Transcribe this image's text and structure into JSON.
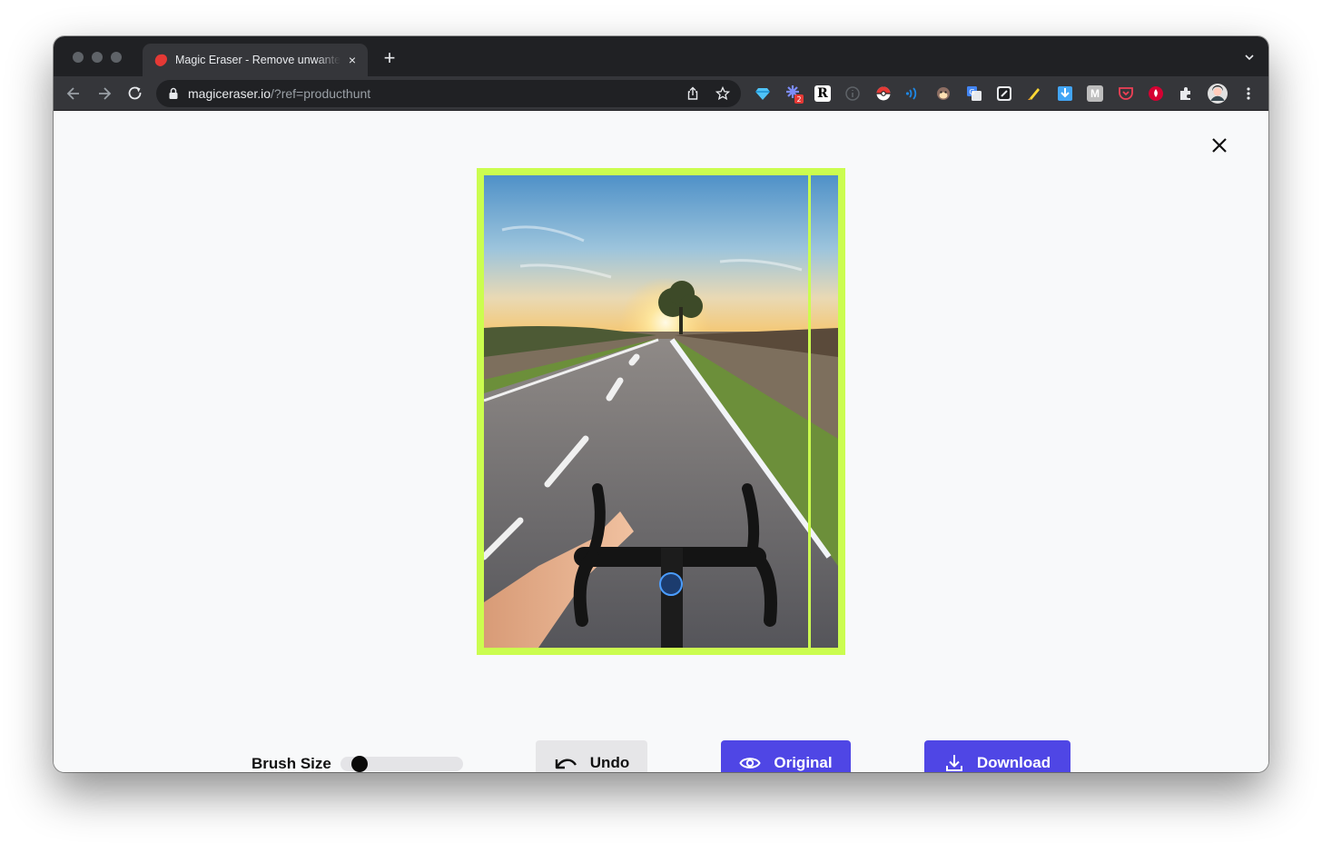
{
  "browser": {
    "tab_title": "Magic Eraser - Remove unwanted things from images",
    "tab_close": "×",
    "new_tab": "+",
    "url_host": "magiceraser.io",
    "url_path": "/?ref=producthunt",
    "extension_badge": "2",
    "extension_letters": [
      "R",
      "M"
    ]
  },
  "editor": {
    "brush_label": "Brush Size",
    "brush_size": 0.1,
    "undo_label": "Undo",
    "original_label": "Original",
    "download_label": "Download"
  },
  "colors": {
    "accent": "#4f46e5",
    "highlight_border": "#cbfd4f",
    "favicon": "#e53935"
  },
  "icons": [
    "back-icon",
    "forward-icon",
    "reload-icon",
    "lock-icon",
    "share-icon",
    "star-icon",
    "close-icon",
    "undo-icon",
    "eye-icon",
    "download-icon"
  ]
}
